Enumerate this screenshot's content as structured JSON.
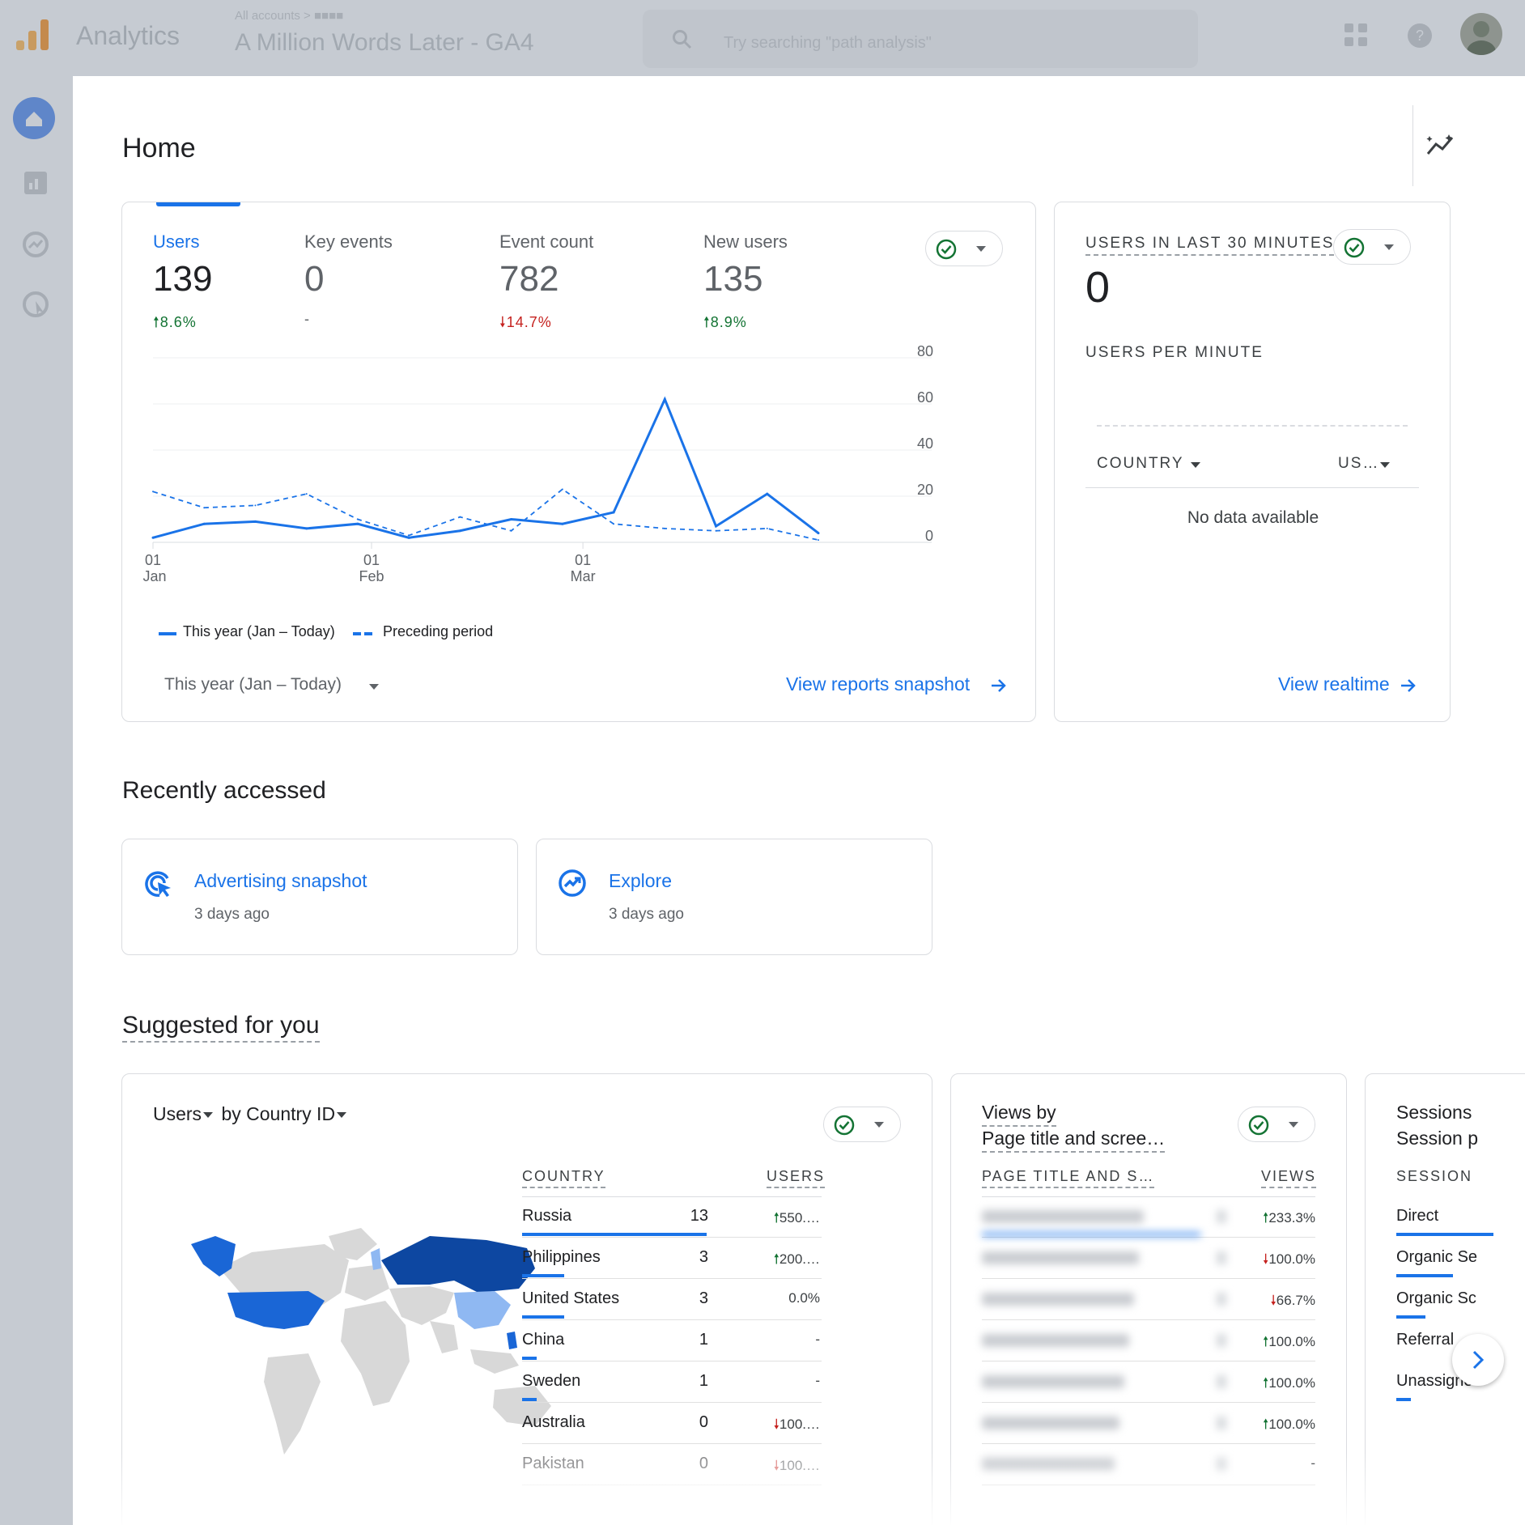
{
  "topbar": {
    "app_name": "Analytics",
    "account": "All accounts > ■■■■",
    "property": "A Million Words Later - GA4",
    "search_placeholder": "Try searching \"path analysis\""
  },
  "page": {
    "title": "Home"
  },
  "overview": {
    "metrics": [
      {
        "label": "Users",
        "value": "139",
        "change": "8.6%",
        "direction": "up"
      },
      {
        "label": "Key events",
        "value": "0",
        "change": "-",
        "direction": "none"
      },
      {
        "label": "Event count",
        "value": "782",
        "change": "14.7%",
        "direction": "down"
      },
      {
        "label": "New users",
        "value": "135",
        "change": "8.9%",
        "direction": "up"
      }
    ],
    "date_range": "This year (Jan – Today)",
    "view_link": "View reports snapshot"
  },
  "chart_data": {
    "type": "line",
    "x_ticks": [
      {
        "day": "01",
        "month": "Jan"
      },
      {
        "day": "01",
        "month": "Feb"
      },
      {
        "day": "01",
        "month": "Mar"
      }
    ],
    "y_ticks": [
      80,
      60,
      40,
      20,
      0
    ],
    "ylim": [
      0,
      80
    ],
    "grid": true,
    "legend_position": "bottom-left",
    "x": [
      0,
      1,
      2,
      3,
      4,
      5,
      6,
      7,
      8,
      9,
      10,
      11,
      12,
      13
    ],
    "series": [
      {
        "name": "This year (Jan – Today)",
        "style": "solid",
        "color": "#1a73e8",
        "values": [
          2,
          8,
          9,
          6,
          8,
          2,
          5,
          10,
          8,
          13,
          62,
          7,
          21,
          4
        ]
      },
      {
        "name": "Preceding period",
        "style": "dashed",
        "color": "#1a73e8",
        "values": [
          22,
          15,
          16,
          21,
          10,
          3,
          11,
          5,
          23,
          8,
          6,
          5,
          6,
          1
        ]
      }
    ]
  },
  "realtime": {
    "title": "USERS IN LAST 30 MINUTES",
    "value": "0",
    "subtitle": "USERS PER MINUTE",
    "col_country": "COUNTRY",
    "col_users": "US…",
    "empty": "No data available",
    "view_link": "View realtime"
  },
  "recent": {
    "title": "Recently accessed",
    "items": [
      {
        "name": "Advertising snapshot",
        "when": "3 days ago",
        "icon": "advertising-icon"
      },
      {
        "name": "Explore",
        "when": "3 days ago",
        "icon": "explore-icon"
      }
    ]
  },
  "suggested": {
    "title": "Suggested for you",
    "country_card": {
      "metric": "Users",
      "dimension": "by Country ID",
      "col_country": "COUNTRY",
      "col_users": "USERS",
      "rows": [
        {
          "country": "Russia",
          "users": "13",
          "change": "550.…",
          "direction": "up",
          "share": 1.0
        },
        {
          "country": "Philippines",
          "users": "3",
          "change": "200.…",
          "direction": "up",
          "share": 0.23
        },
        {
          "country": "United States",
          "users": "3",
          "change": "0.0%",
          "direction": "none",
          "share": 0.23
        },
        {
          "country": "China",
          "users": "1",
          "change": "-",
          "direction": "none",
          "share": 0.08
        },
        {
          "country": "Sweden",
          "users": "1",
          "change": "-",
          "direction": "none",
          "share": 0.08
        },
        {
          "country": "Australia",
          "users": "0",
          "change": "100.…",
          "direction": "down",
          "share": 0
        },
        {
          "country": "Pakistan",
          "users": "0",
          "change": "100.…",
          "direction": "down",
          "share": 0
        }
      ]
    },
    "views_card": {
      "title_line1": "Views by",
      "title_line2": "Page title and scree…",
      "col_page": "PAGE TITLE AND S…",
      "col_views": "VIEWS",
      "rows": [
        {
          "change": "233.3%",
          "direction": "up"
        },
        {
          "change": "100.0%",
          "direction": "down"
        },
        {
          "change": "66.7%",
          "direction": "down"
        },
        {
          "change": "100.0%",
          "direction": "up"
        },
        {
          "change": "100.0%",
          "direction": "up"
        },
        {
          "change": "100.0%",
          "direction": "up"
        },
        {
          "change": "-",
          "direction": "none"
        }
      ]
    },
    "sessions_card": {
      "title_line1": "Sessions",
      "title_line2": "Session p",
      "col": "SESSION",
      "rows": [
        "Direct",
        "Organic Se",
        "Organic Sc",
        "Referral",
        "Unassigne"
      ]
    }
  }
}
